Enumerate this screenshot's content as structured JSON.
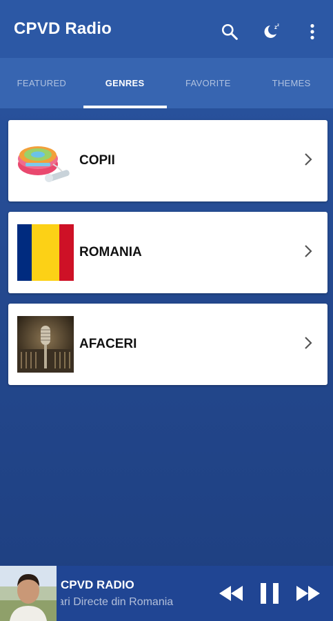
{
  "app": {
    "title": "CPVD Radio"
  },
  "appbar_icons": [
    "search-icon",
    "sleep-timer-icon",
    "more-vert-icon"
  ],
  "tabs": [
    {
      "label": "FEATURED",
      "active": false
    },
    {
      "label": "GENRES",
      "active": true
    },
    {
      "label": "FAVORITE",
      "active": false
    },
    {
      "label": "THEMES",
      "active": false
    }
  ],
  "genres": [
    {
      "label": "COPII",
      "thumb": "cd-player-toy-image"
    },
    {
      "label": "ROMANIA",
      "thumb": "romania-flag-image"
    },
    {
      "label": "AFACERI",
      "thumb": "microphone-image"
    }
  ],
  "player": {
    "title": "CPVD RADIO",
    "subtitle": "ari Directe din Romania",
    "controls": [
      "rewind-icon",
      "pause-icon",
      "fast-forward-icon"
    ]
  },
  "colors": {
    "appbar": "#2c58a5",
    "tabbar": "#3765b1",
    "background": "#24498f",
    "player": "#204593",
    "flag_blue": "#002b7f",
    "flag_yellow": "#fcd116",
    "flag_red": "#ce1126"
  }
}
